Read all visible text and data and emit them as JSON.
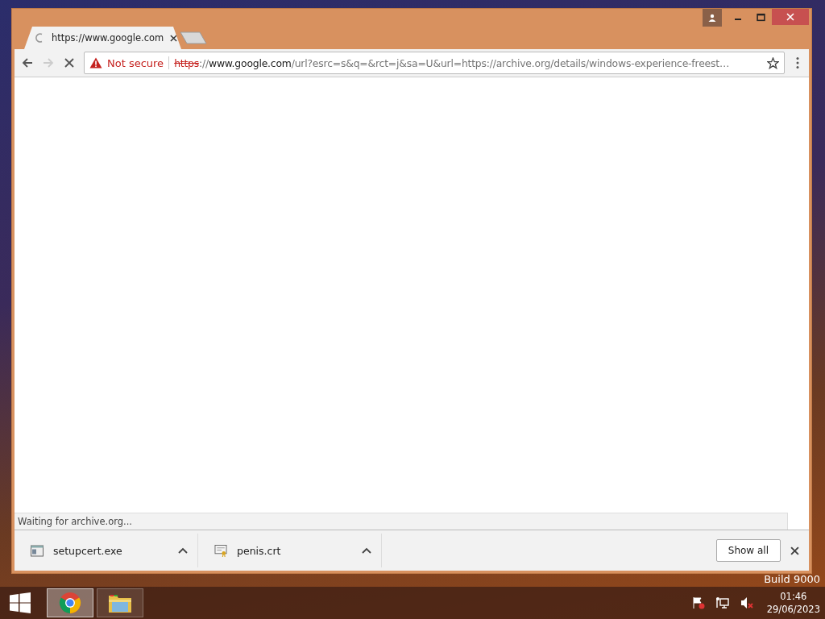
{
  "desktop": {
    "build_text": "Build 9000"
  },
  "window": {
    "tabs": [
      {
        "title": "https://www.google.com",
        "selected": true,
        "loading": true
      }
    ],
    "toolbar": {
      "back_disabled": false,
      "forward_disabled": true,
      "loading": true
    },
    "address": {
      "security": "Not secure",
      "scheme": "https",
      "separator": "://",
      "host": "www.google.com",
      "path": "/url?esrc=s&q=&rct=j&sa=U&url=https://archive.org/details/windows-experience-freest…"
    },
    "status": "Waiting for archive.org...",
    "downloads": [
      {
        "name": "setupcert.exe",
        "kind": "exe"
      },
      {
        "name": "penis.crt",
        "kind": "cert"
      }
    ],
    "show_all": "Show all"
  },
  "taskbar": {
    "apps": [
      {
        "kind": "browser",
        "selected": true
      },
      {
        "kind": "explorer",
        "selected": false
      }
    ],
    "time": "01:46",
    "date": "29/06/2023"
  }
}
